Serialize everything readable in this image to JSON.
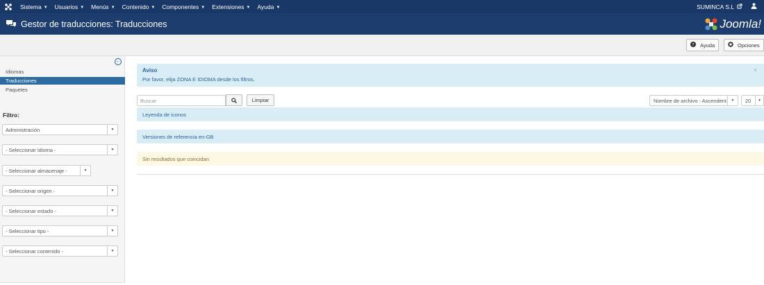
{
  "topnav": {
    "menu": [
      {
        "label": "Sistema"
      },
      {
        "label": "Usuarios"
      },
      {
        "label": "Menús"
      },
      {
        "label": "Contenido"
      },
      {
        "label": "Componentes"
      },
      {
        "label": "Extensiones"
      },
      {
        "label": "Ayuda"
      }
    ],
    "site_name": "SUMINCA S.L",
    "icons": [
      "joomla-icon",
      "external-link-icon",
      "user-icon"
    ]
  },
  "header": {
    "title": "Gestor de traducciones: Traducciones",
    "icon": "comments-icon",
    "logo_text": "Joomla!"
  },
  "toolbar": {
    "help_label": "Ayuda",
    "options_label": "Opciones"
  },
  "sidebar": {
    "links": [
      {
        "label": "Idiomas",
        "active": false
      },
      {
        "label": "Traducciones",
        "active": true
      },
      {
        "label": "Paquetes",
        "active": false
      }
    ],
    "filter_title": "Filtro:",
    "filters": [
      {
        "value": "Administración"
      },
      {
        "value": "- Seleccionar idioma -"
      },
      {
        "value": "- Seleccionar almacenaje -"
      },
      {
        "value": "- Seleccionar origen -"
      },
      {
        "value": "- Seleccionar estado -"
      },
      {
        "value": "- Seleccionar tipo -"
      },
      {
        "value": "- Seleccionar contenido -"
      }
    ]
  },
  "notice": {
    "heading": "Aviso",
    "message": "Por favor, elija ZONA E IDIOMA desde los filtros."
  },
  "search": {
    "placeholder": "Buscar",
    "clear_label": "Limpiar"
  },
  "sort": {
    "value": "Nombre de archivo - Ascendent",
    "limit": "20"
  },
  "panels": {
    "legend": "Leyenda de iconos",
    "reference": "Versiones de referencia en-GB",
    "no_results": "Sin resultados que coincidan"
  },
  "colors": {
    "topnav_bg": "#1a3867",
    "header_bg": "#1c3d6e",
    "active_link": "#2d6ca2",
    "info_bg": "#d9edf7",
    "warning_bg": "#fcf8e3"
  }
}
